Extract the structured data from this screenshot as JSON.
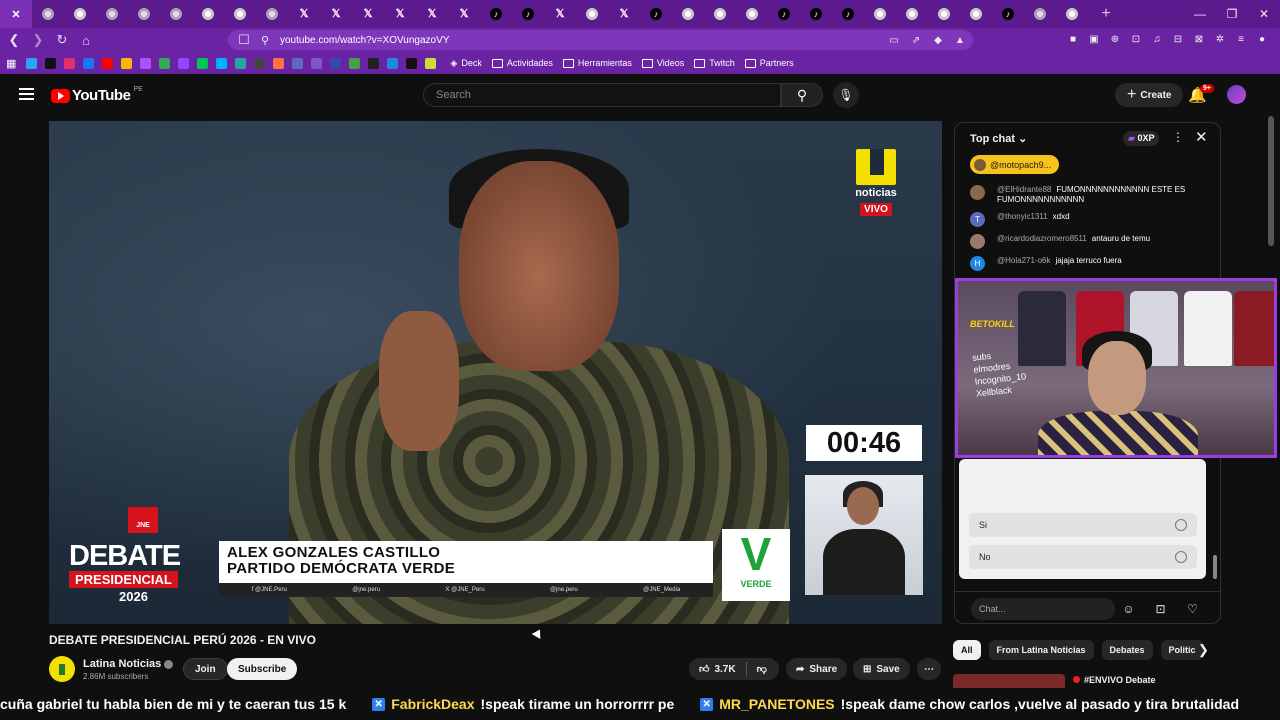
{
  "browser": {
    "url": "youtube.com/watch?v=XOVungazoVY",
    "bookmarks": [
      "Deck",
      "Actividades",
      "Herramientas",
      "Videos",
      "Twitch",
      "Partners"
    ]
  },
  "youtube": {
    "logo_text": "YouTube",
    "country": "PE",
    "search_placeholder": "Search",
    "create_label": "Create",
    "notification_count": "9+"
  },
  "video": {
    "overlay": {
      "brand_name": "noticias",
      "live_label": "VIVO",
      "timer": "00:46",
      "jne_label": "JNE",
      "debate_word": "DEBATE",
      "debate_sub": "PRESIDENCIAL",
      "debate_year": "2026",
      "candidate_name": "ALEX GONZALES CASTILLO",
      "candidate_party": "PARTIDO DEMÓCRATA VERDE",
      "social": [
        "f @JNE.Peru",
        "@jne.peru",
        "X @JNE_Peru",
        "@jne.peru",
        "@JNE_Media"
      ],
      "party_logo_letter": "V",
      "party_logo_text": "VERDE"
    },
    "title": "DEBATE PRESIDENCIAL PERÚ 2026 - EN VIVO",
    "channel_name": "Latina Noticias",
    "subscribers": "2.86M subscribers",
    "join_label": "Join",
    "subscribe_label": "Subscribe",
    "likes": "3.7K",
    "share_label": "Share",
    "save_label": "Save"
  },
  "chat": {
    "mode_label": "Top chat",
    "xp_label": "0XP",
    "pinned_user": "@motopach9...",
    "messages": [
      {
        "user": "@ElHidrante88",
        "text": "FUMONNNNNNNNNNNN ESTE ES FUMONNNNNNNNNNN",
        "avatar_color": "#8a6a4a",
        "initial": ""
      },
      {
        "user": "@thonyic1311",
        "text": "xdxd",
        "avatar_color": "#5c6bc0",
        "initial": "T"
      },
      {
        "user": "@ricardodiazromero8511",
        "text": "antauru de temu",
        "avatar_color": "#9a7a6a",
        "initial": ""
      },
      {
        "user": "@Hola271-o6k",
        "text": "jajaja terruco fuera",
        "avatar_color": "#1e88e5",
        "initial": "H"
      }
    ],
    "poll_options": [
      "Si",
      "No"
    ],
    "input_placeholder": "Chat..."
  },
  "webcam": {
    "brand": "BETOKILL",
    "list": [
      "subs",
      "elmodres",
      "Incognito_10",
      "Xellblack"
    ]
  },
  "chips": [
    "All",
    "From Latina Noticias",
    "Debates",
    "Politic"
  ],
  "recommendation_title": "#ENVIVO Debate",
  "ticker": [
    {
      "user": "",
      "text": "cuña gabriel tu habla bien de mi y te caeran tus 15 k"
    },
    {
      "user": "FabrickDeax",
      "text": "!speak tirame un horrorrrr pe"
    },
    {
      "user": "MR_PANETONES",
      "text": "!speak dame chow carlos ,vuelve al pasado y tira brutalidad"
    }
  ],
  "colors": {
    "browser_tabstrip": "#5b1a8e",
    "browser_toolbar": "#6a23a3",
    "yt_red": "#ff0000",
    "webcam_border": "#9b3de3",
    "party_green": "#1ea23a",
    "jne_red": "#d5131c",
    "latina_yellow": "#f3df00"
  }
}
